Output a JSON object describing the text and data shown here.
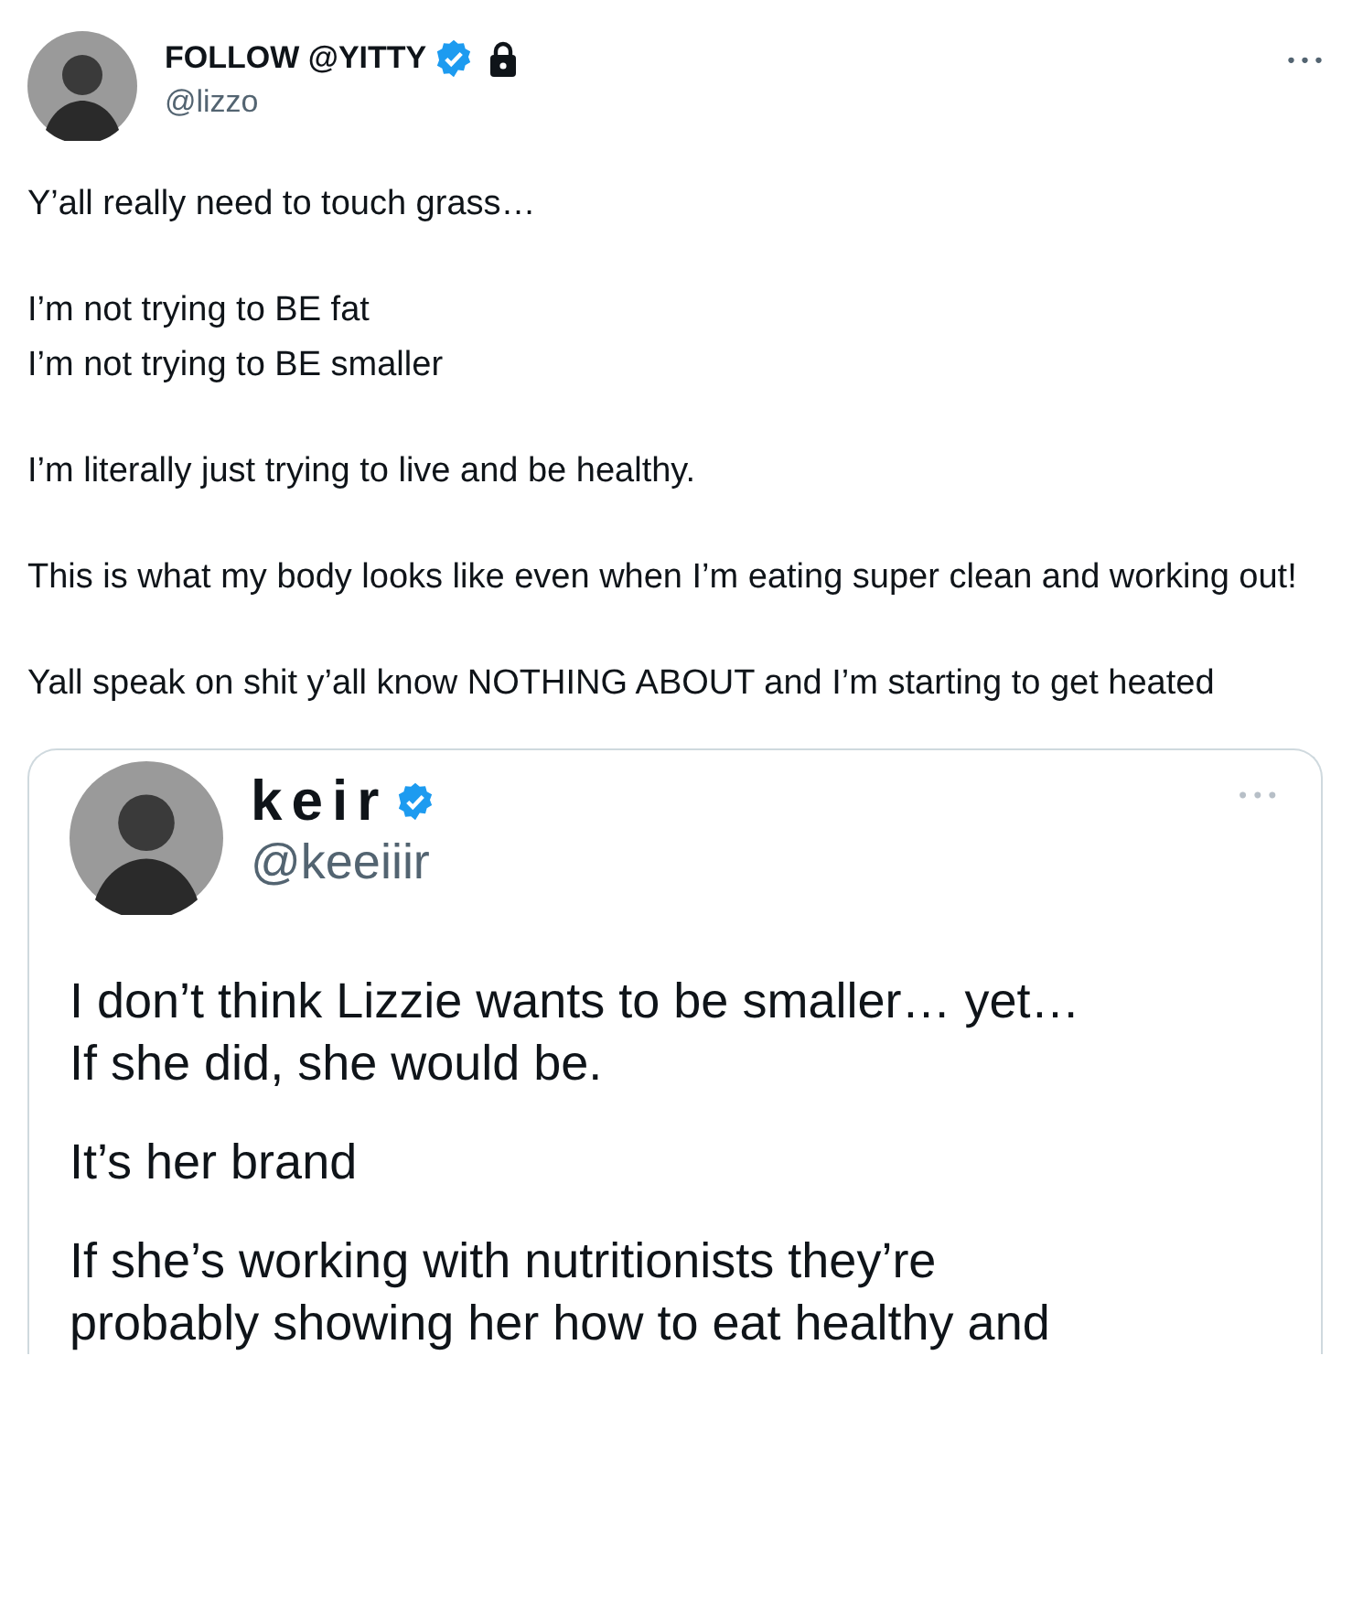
{
  "tweet": {
    "display_name": "FOLLOW @YITTY",
    "verified": true,
    "protected": true,
    "handle": "@lizzo",
    "more": "•••",
    "paragraphs": [
      [
        "Y’all really need to touch grass…"
      ],
      [
        "I’m not trying to BE fat",
        "I’m not trying to BE smaller"
      ],
      [
        "I’m literally just trying to live and be healthy."
      ],
      [
        "This is what my body looks like even when I’m eating super clean and working out!"
      ],
      [
        "Yall speak on shit y’all know NOTHING ABOUT and I’m starting to get heated"
      ]
    ]
  },
  "quoted": {
    "display_name": "keir",
    "verified": true,
    "handle": "@keeiiir",
    "more": "•••",
    "paragraphs": [
      [
        "I don’t think Lizzie wants to be smaller…  yet…",
        "If she did, she would be."
      ],
      [
        "It’s her brand"
      ],
      [
        "If she’s working with nutritionists they’re",
        "probably showing her how to eat healthy and"
      ]
    ]
  }
}
